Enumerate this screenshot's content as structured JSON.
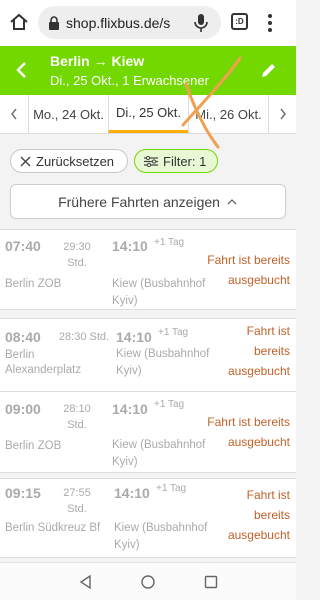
{
  "browser": {
    "url": "shop.flixbus.de/s",
    "tabs_count": ":D"
  },
  "header": {
    "route": "Berlin → Kiew",
    "details": "Di., 25 Okt., 1 Erwachsener"
  },
  "dates": [
    {
      "label": "Mo., 24 Okt."
    },
    {
      "label": "Di., 25 Okt."
    },
    {
      "label": "Mi., 26 Okt."
    }
  ],
  "filters": {
    "reset_label": "Zurücksetzen",
    "filter_label": "Filter: 1"
  },
  "earlier_label": "Frühere Fahrten anzeigen",
  "trips": [
    {
      "dep": "07:40",
      "duration_a": "29:30",
      "duration_b": "Std.",
      "arr": "14:10",
      "plus": "+1 Tag",
      "from_a": "Berlin ZOB",
      "from_b": "",
      "to_a": "Kiew (Busbahnhof",
      "to_b": "Kyiv)",
      "status_a": "Fahrt ist bereits",
      "status_b": "ausgebucht"
    },
    {
      "dep": "08:40",
      "duration_a": "28:30 Std.",
      "duration_b": "",
      "arr": "14:10",
      "plus": "+1 Tag",
      "from_a": "Berlin",
      "from_b": "Alexanderplatz",
      "to_a": "Kiew (Busbahnhof",
      "to_b": "Kyiv)",
      "status_a": "Fahrt ist",
      "status_b": "bereits",
      "status_c": "ausgebucht"
    },
    {
      "dep": "09:00",
      "duration_a": "28:10",
      "duration_b": "Std.",
      "arr": "14:10",
      "plus": "+1 Tag",
      "from_a": "Berlin ZOB",
      "from_b": "",
      "to_a": "Kiew (Busbahnhof",
      "to_b": "Kyiv)",
      "status_a": "Fahrt ist bereits",
      "status_b": "ausgebucht"
    },
    {
      "dep": "09:15",
      "duration_a": "27:55",
      "duration_b": "Std.",
      "arr": "14:10",
      "plus": "+1 Tag",
      "from_a": "Berlin Südkreuz Bf",
      "from_b": "",
      "to_a": "Kiew (Busbahnhof",
      "to_b": "Kyiv)",
      "status_a": "Fahrt ist",
      "status_b": "bereits",
      "status_c": "ausgebucht"
    }
  ],
  "colors": {
    "brand_green": "#73d700",
    "active_tab_underline": "#ffad00",
    "sold_out_text": "#c0612a",
    "annotation_x": "#f0a050"
  }
}
